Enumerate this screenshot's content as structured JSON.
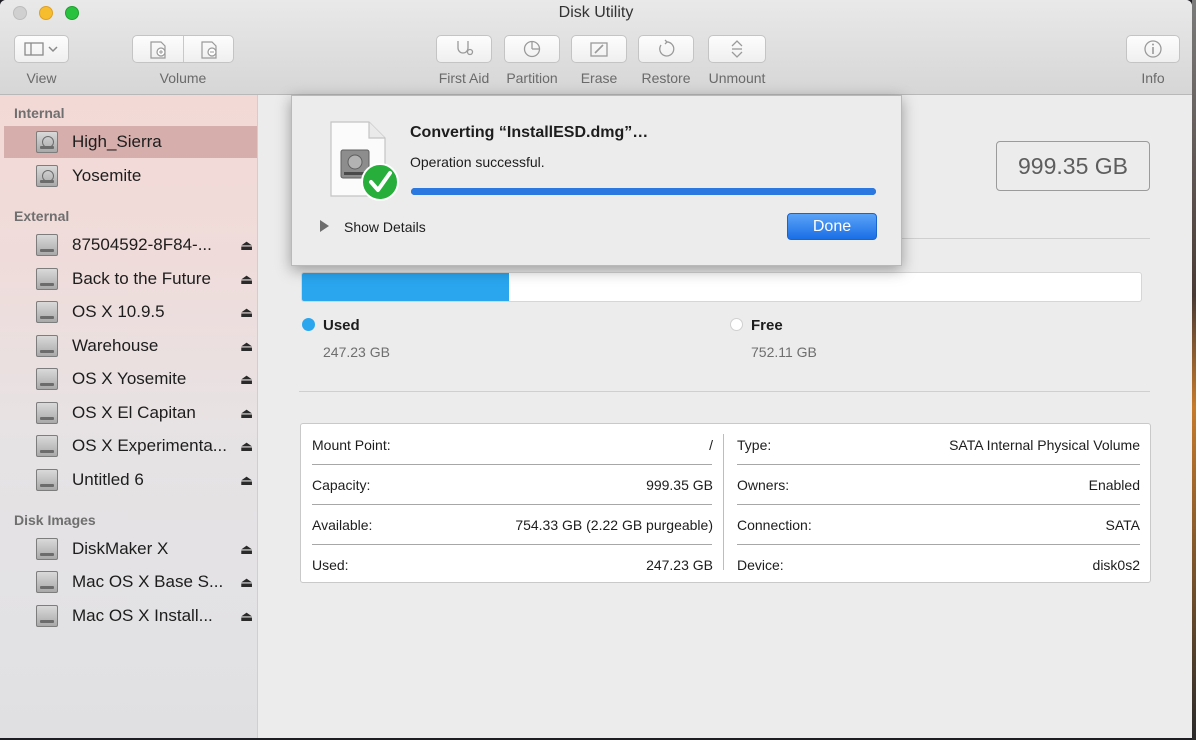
{
  "window": {
    "title": "Disk Utility"
  },
  "toolbar": {
    "view_label": "View",
    "volume_label": "Volume",
    "first_aid_label": "First Aid",
    "partition_label": "Partition",
    "erase_label": "Erase",
    "restore_label": "Restore",
    "unmount_label": "Unmount",
    "info_label": "Info"
  },
  "sidebar": {
    "sections": [
      {
        "header": "Internal",
        "items": [
          {
            "label": "High_Sierra",
            "selected": true,
            "eject": false
          },
          {
            "label": "Yosemite",
            "selected": false,
            "eject": false
          }
        ]
      },
      {
        "header": "External",
        "items": [
          {
            "label": "87504592-8F84-...",
            "eject": true
          },
          {
            "label": "Back to the Future",
            "eject": true
          },
          {
            "label": "OS X 10.9.5",
            "eject": true
          },
          {
            "label": "Warehouse",
            "eject": true
          },
          {
            "label": "OS X Yosemite",
            "eject": true
          },
          {
            "label": "OS X El Capitan",
            "eject": true
          },
          {
            "label": "OS X Experimenta...",
            "eject": true
          },
          {
            "label": "Untitled 6",
            "eject": true
          }
        ]
      },
      {
        "header": "Disk Images",
        "items": [
          {
            "label": "DiskMaker X",
            "eject": true
          },
          {
            "label": "Mac OS X Base S...",
            "eject": true
          },
          {
            "label": "Mac OS X Install...",
            "eject": true
          }
        ]
      }
    ],
    "eject_glyph": "⏏"
  },
  "main": {
    "capacity": "999.35 GB",
    "usage": {
      "used_fraction": 0.247,
      "used_label": "Used",
      "used_value": "247.23 GB",
      "free_label": "Free",
      "free_value": "752.11 GB",
      "used_color": "#2aa6ef"
    },
    "info": {
      "mount_point_key": "Mount Point:",
      "mount_point_val": "/",
      "capacity_key": "Capacity:",
      "capacity_val": "999.35 GB",
      "available_key": "Available:",
      "available_val": "754.33 GB (2.22 GB purgeable)",
      "used_key": "Used:",
      "used_val": "247.23 GB",
      "type_key": "Type:",
      "type_val": "SATA Internal Physical Volume",
      "owners_key": "Owners:",
      "owners_val": "Enabled",
      "connection_key": "Connection:",
      "connection_val": "SATA",
      "device_key": "Device:",
      "device_val": "disk0s2"
    }
  },
  "dialog": {
    "title": "Converting “InstallESD.dmg”…",
    "status": "Operation successful.",
    "progress": 1.0,
    "details_label": "Show Details",
    "done_label": "Done",
    "accent": "#2b78e0"
  }
}
